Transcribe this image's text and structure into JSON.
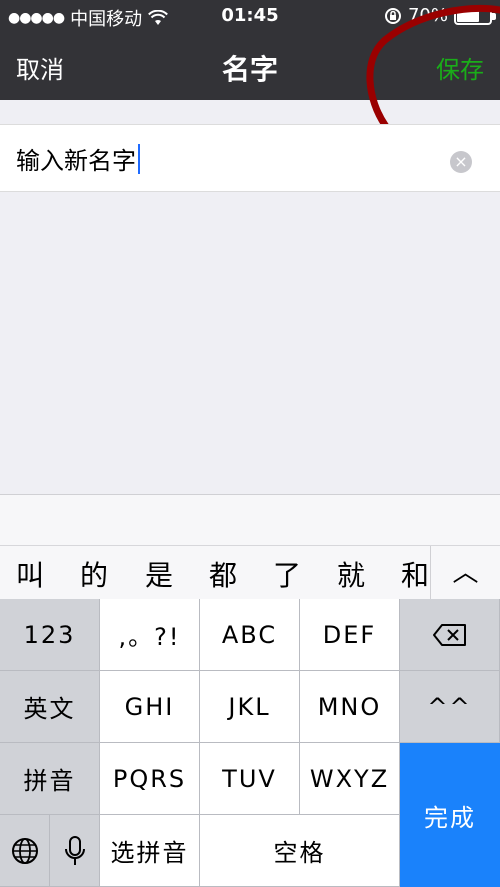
{
  "status": {
    "carrier": "中国移动",
    "time": "01:45",
    "battery_percent": "70%",
    "battery_level": 0.7
  },
  "nav": {
    "cancel_label": "取消",
    "title": "名字",
    "save_label": "保存",
    "save_color": "#1aad19"
  },
  "input": {
    "value": "输入新名字",
    "clear_icon": "clear-circle-icon"
  },
  "candidates": [
    "叫",
    "的",
    "是",
    "都",
    "了",
    "就",
    "和"
  ],
  "keyboard": {
    "row1": [
      "123",
      ",。?!",
      "ABC",
      "DEF"
    ],
    "row2": [
      "英文",
      "GHI",
      "JKL",
      "MNO",
      "^^"
    ],
    "row3": [
      "拼音",
      "PQRS",
      "TUV",
      "WXYZ"
    ],
    "row4": [
      "选拼音",
      "空格"
    ],
    "done_label": "完成",
    "accent": "#1a82fb"
  }
}
